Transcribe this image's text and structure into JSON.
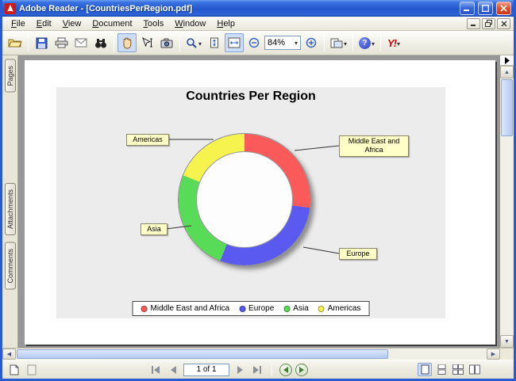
{
  "window": {
    "title": "Adobe Reader - [CountriesPerRegion.pdf]"
  },
  "menu": {
    "items": [
      "File",
      "Edit",
      "View",
      "Document",
      "Tools",
      "Window",
      "Help"
    ]
  },
  "toolbar": {
    "zoom_value": "84%",
    "yahoo_label": "Y!"
  },
  "sidebar": {
    "tabs": [
      "Pages",
      "Attachments",
      "Comments"
    ]
  },
  "statusbar": {
    "page_indicator": "1 of 1"
  },
  "chart_data": {
    "type": "pie",
    "subtype": "donut",
    "title": "Countries Per Region",
    "categories": [
      "Middle East and Africa",
      "Europe",
      "Asia",
      "Americas"
    ],
    "values": [
      27,
      29,
      25,
      19
    ],
    "values_are_percent_estimated": true,
    "colors": [
      "#fa5a5a",
      "#5a5af0",
      "#58dc58",
      "#f6f24e"
    ],
    "start_angle_deg": 0,
    "legend_position": "bottom",
    "callout_labels": [
      "Middle East and Africa",
      "Europe",
      "Asia",
      "Americas"
    ]
  }
}
